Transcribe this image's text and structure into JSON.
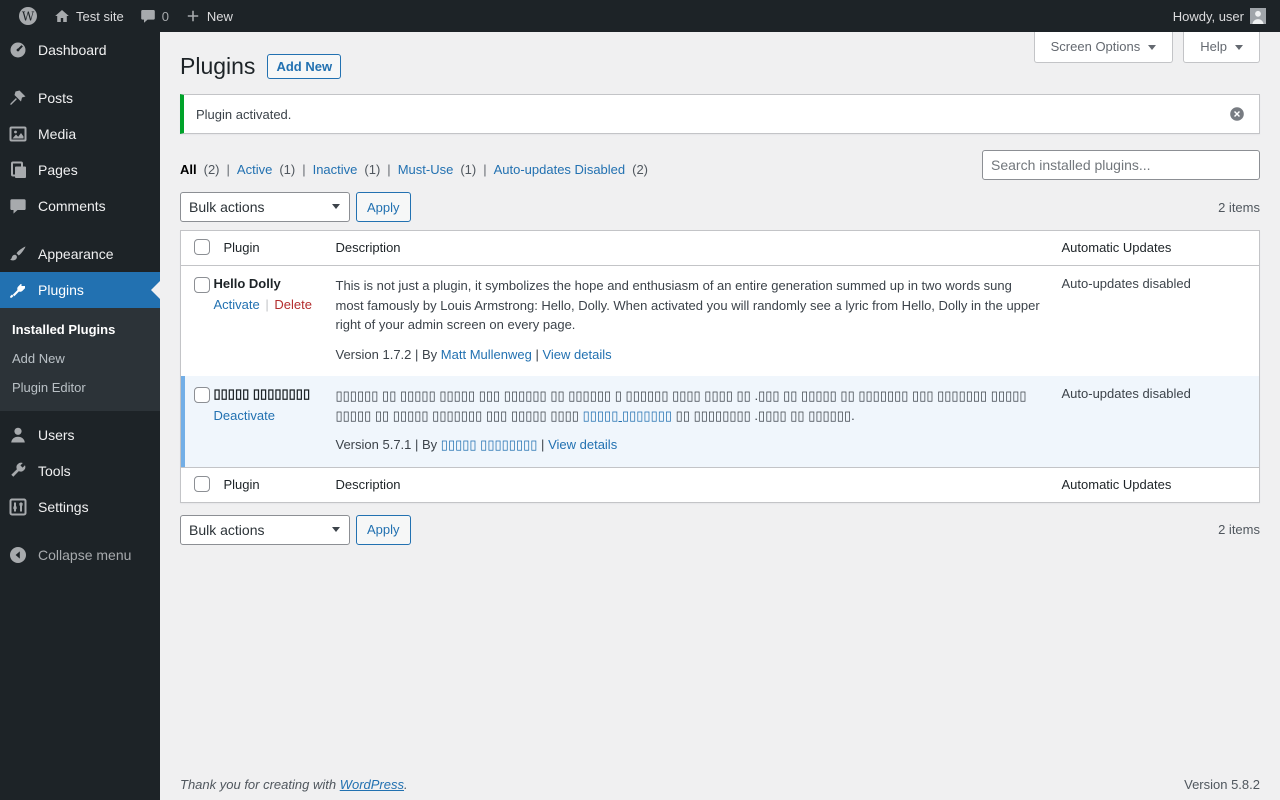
{
  "ui": {
    "pipe": "|"
  },
  "colors": {
    "accent_blue": "#2271b1",
    "sidebar_bg": "#1d2327",
    "active_row_bg": "#f0f6fc",
    "active_row_border": "#72aee6",
    "notice_green": "#00a32a",
    "delete_red": "#b32d2e"
  },
  "admin_bar": {
    "site_name": "Test site",
    "comments_count": "0",
    "new_label": "New",
    "howdy": "Howdy, user"
  },
  "sidebar": {
    "items": [
      {
        "label": "Dashboard"
      },
      {
        "label": "Posts"
      },
      {
        "label": "Media"
      },
      {
        "label": "Pages"
      },
      {
        "label": "Comments"
      },
      {
        "label": "Appearance"
      },
      {
        "label": "Plugins"
      },
      {
        "label": "Users"
      },
      {
        "label": "Tools"
      },
      {
        "label": "Settings"
      },
      {
        "label": "Collapse menu"
      }
    ],
    "submenu": [
      {
        "label": "Installed Plugins"
      },
      {
        "label": "Add New"
      },
      {
        "label": "Plugin Editor"
      }
    ]
  },
  "header": {
    "title": "Plugins",
    "add_new_label": "Add New",
    "screen_options_label": "Screen Options",
    "help_label": "Help"
  },
  "notice": {
    "message": "Plugin activated."
  },
  "filters": {
    "all": {
      "label": "All",
      "count": "(2)"
    },
    "active": {
      "label": "Active",
      "count": "(1)"
    },
    "inactive": {
      "label": "Inactive",
      "count": "(1)"
    },
    "mustuse": {
      "label": "Must-Use",
      "count": "(1)"
    },
    "autoupdates": {
      "label": "Auto-updates Disabled",
      "count": "(2)"
    }
  },
  "search": {
    "placeholder": "Search installed plugins..."
  },
  "tablenav": {
    "bulk_actions": "Bulk actions",
    "apply_label": "Apply",
    "items_count": "2 items"
  },
  "table": {
    "headers": {
      "plugin": "Plugin",
      "description": "Description",
      "auto_updates": "Automatic Updates"
    },
    "rows": [
      {
        "name": "Hello Dolly",
        "activate_label": "Activate",
        "delete_label": "Delete",
        "description": "This is not just a plugin, it symbolizes the hope and enthusiasm of an entire generation summed up in two words sung most famously by Louis Armstrong: Hello, Dolly. When activated you will randomly see a lyric from Hello, Dolly in the upper right of your admin screen on every page.",
        "version_by": "Version 1.7.2 | By",
        "author": "Matt Mullenweg",
        "view_details": "View details",
        "auto_updates": "Auto-updates disabled"
      },
      {
        "name": "▯▯▯▯▯ ▯▯▯▯▯▯▯▯",
        "deactivate_label": "Deactivate",
        "description_before_link": "▯▯▯▯▯▯ ▯▯ ▯▯▯▯▯ ▯▯▯▯▯ ▯▯▯ ▯▯▯▯▯▯ ▯▯ ▯▯▯▯▯▯ ▯ ▯▯▯▯▯▯ ▯▯▯▯ ▯▯▯▯ ▯▯ .▯▯▯ ▯▯ ▯▯▯▯▯ ▯▯ ▯▯▯▯▯▯▯ ▯▯▯ ▯▯▯▯▯▯▯ ▯▯▯▯▯ ▯▯▯▯▯ ▯▯ ▯▯▯▯▯ ▯▯▯▯▯▯▯ ▯▯▯ ▯▯▯▯▯ ▯▯▯▯",
        "description_link": "▯▯▯▯▯ ▯▯▯▯▯▯▯",
        "description_after_link": "▯▯ ▯▯▯▯▯▯▯▯ .▯▯▯▯ ▯▯ ▯▯▯▯▯▯.",
        "version_by": "Version 5.7.1 | By",
        "author": "▯▯▯▯▯ ▯▯▯▯▯▯▯▯",
        "view_details": "View details",
        "auto_updates": "Auto-updates disabled"
      }
    ]
  },
  "footer": {
    "thanks_prefix": "Thank you for creating with",
    "wordpress_link": "WordPress",
    "thanks_suffix": ".",
    "version": "Version 5.8.2"
  }
}
